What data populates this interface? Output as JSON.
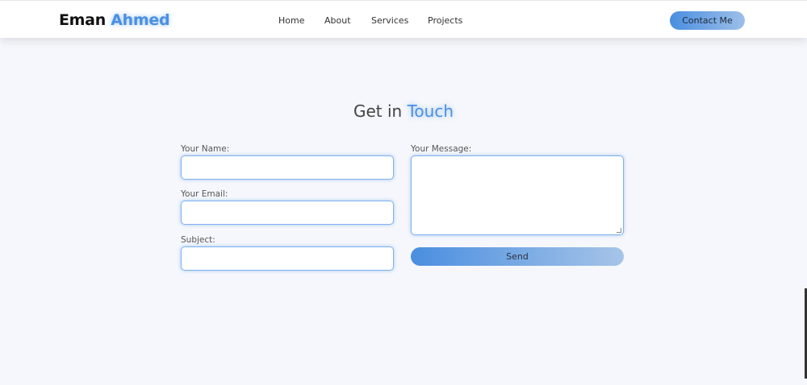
{
  "header": {
    "brand_first": "Eman",
    "brand_last": "Ahmed",
    "nav": [
      "Home",
      "About",
      "Services",
      "Projects"
    ],
    "cta_label": "Contact Me"
  },
  "contact": {
    "title_prefix": "Get in",
    "title_accent": "Touch",
    "fields": {
      "name_label": "Your Name:",
      "email_label": "Your Email:",
      "subject_label": "Subject:",
      "message_label": "Your Message:",
      "name_value": "",
      "email_value": "",
      "subject_value": "",
      "message_value": ""
    },
    "send_label": "Send"
  },
  "colors": {
    "accent": "#4a90e2",
    "background": "#f5f7fc",
    "navbar": "#ffffff"
  }
}
